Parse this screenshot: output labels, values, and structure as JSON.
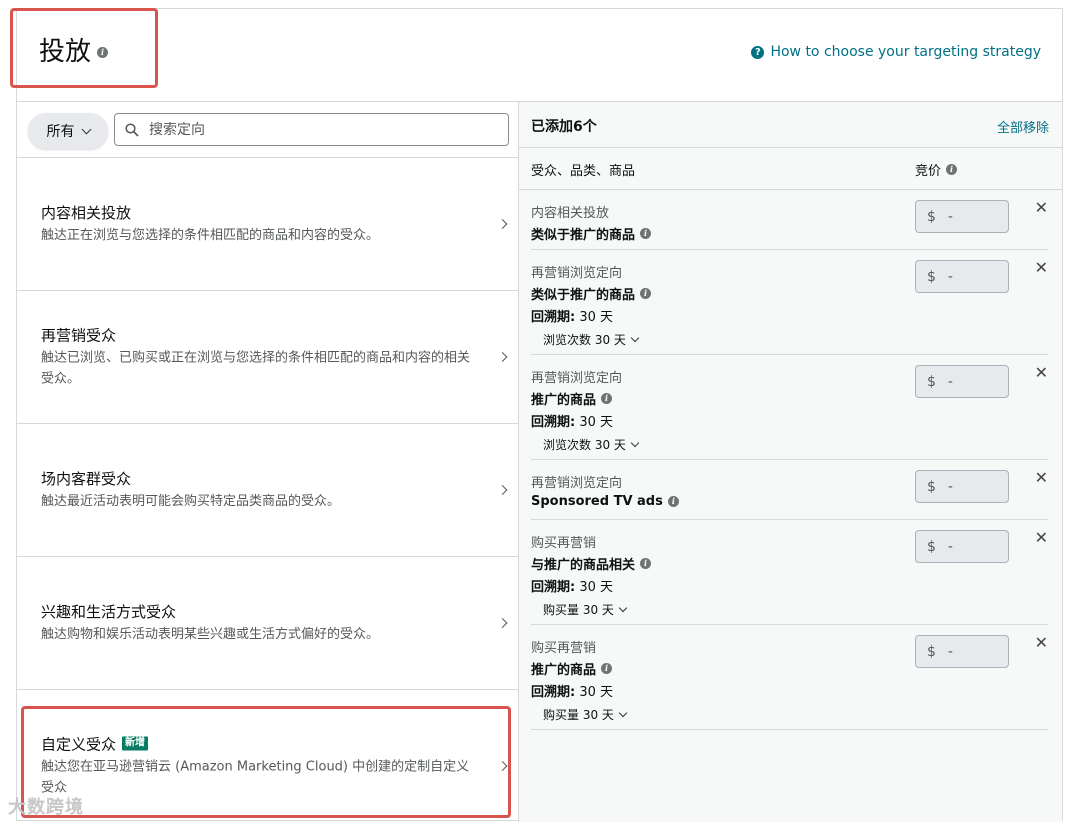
{
  "header": {
    "title": "投放",
    "help_link": "How to choose your targeting strategy"
  },
  "left": {
    "filter": {
      "dropdown_label": "所有",
      "search_placeholder": "搜索定向"
    },
    "categories": [
      {
        "title": "内容相关投放",
        "desc": "触达正在浏览与您选择的条件相匹配的商品和内容的受众。"
      },
      {
        "title": "再营销受众",
        "desc": "触达已浏览、已购买或正在浏览与您选择的条件相匹配的商品和内容的相关受众。"
      },
      {
        "title": "场内客群受众",
        "desc": "触达最近活动表明可能会购买特定品类商品的受众。"
      },
      {
        "title": "兴趣和生活方式受众",
        "desc": "触达购物和娱乐活动表明某些兴趣或生活方式偏好的受众。"
      },
      {
        "title": "自定义受众",
        "badge": "新增",
        "desc": "触达您在亚马逊营销云 (Amazon Marketing Cloud) 中创建的定制自定义受众"
      }
    ]
  },
  "right": {
    "added_count": "已添加6个",
    "remove_all": "全部移除",
    "col_audience": "受众、品类、商品",
    "col_bid": "竞价",
    "currency": "$",
    "bid_placeholder": "-",
    "lookback_label": "回溯期:",
    "rows": [
      {
        "category": "内容相关投放",
        "target": "类似于推广的商品"
      },
      {
        "category": "再营销浏览定向",
        "target": "类似于推广的商品",
        "lookback": "30 天",
        "sub": "浏览次数 30 天"
      },
      {
        "category": "再营销浏览定向",
        "target": "推广的商品",
        "lookback": "30 天",
        "sub": "浏览次数 30 天"
      },
      {
        "category": "再营销浏览定向",
        "target": "Sponsored TV ads"
      },
      {
        "category": "购买再营销",
        "target": "与推广的商品相关",
        "lookback": "30 天",
        "sub": "购买量 30 天"
      },
      {
        "category": "购买再营销",
        "target": "推广的商品",
        "lookback": "30 天",
        "sub": "购买量 30 天"
      }
    ]
  },
  "watermark": "大数跨境"
}
